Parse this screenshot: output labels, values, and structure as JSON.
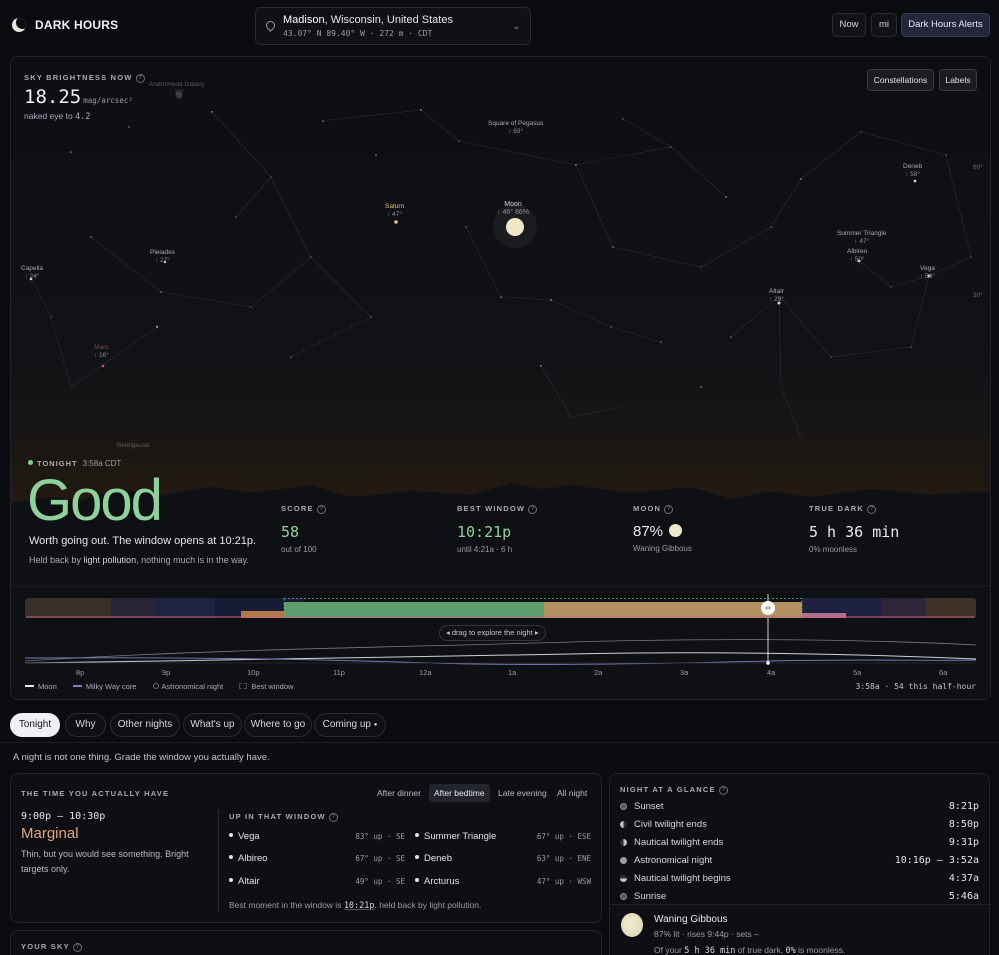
{
  "app": {
    "title": "DARK HOURS"
  },
  "location": {
    "city": "Madison",
    "region": ", Wisconsin, United States",
    "coords": "43.07° N 89.40° W · 272 m · CDT"
  },
  "header_buttons": {
    "now": "Now",
    "units": "mi",
    "alerts": "Dark Hours Alerts"
  },
  "sky": {
    "brightness_label": "SKY BRIGHTNESS NOW",
    "brightness_value": "18.25",
    "brightness_unit": "mag/arcsec²",
    "naked_eye_prefix": "naked eye to",
    "naked_eye_value": "4.2",
    "toggle_constellations": "Constellations",
    "toggle_labels": "Labels",
    "altitude_ticks": [
      "60°",
      "30°"
    ],
    "objects": [
      {
        "name": "Andromeda Galaxy",
        "alt": "↑ 19°"
      },
      {
        "name": "Square of Pegasus",
        "alt": "↑ 69°"
      },
      {
        "name": "Moon",
        "alt": "↑ 46° 86%"
      },
      {
        "name": "Saturn",
        "alt": "↑ 47°"
      },
      {
        "name": "Deneb",
        "alt": "↑ 58°"
      },
      {
        "name": "Summer Triangle",
        "alt": "↑ 47°"
      },
      {
        "name": "Albireo",
        "alt": "↑ 50°"
      },
      {
        "name": "Vega",
        "alt": "↑ 54°"
      },
      {
        "name": "Pleiades",
        "alt": "↑ 27°"
      },
      {
        "name": "Capella",
        "alt": "↑ 24°"
      },
      {
        "name": "Altair",
        "alt": "↑ 29°"
      },
      {
        "name": "Mars",
        "alt": "↑ 16°"
      },
      {
        "name": "Betelgeuse",
        "alt": ""
      }
    ]
  },
  "tonight": {
    "label": "TONIGHT",
    "time": "3:58a CDT",
    "verdict": "Good",
    "summary": "Worth going out. The window opens at 10:21p.",
    "note_prefix": "Held back by ",
    "note_bold": "light pollution",
    "note_suffix": ", nothing much is in the way."
  },
  "stats": {
    "score": {
      "label": "SCORE",
      "value": "58",
      "sub": "out of 100"
    },
    "best_window": {
      "label": "BEST WINDOW",
      "value": "10:21p",
      "sub": "until 4:21a · 6 h"
    },
    "moon": {
      "label": "MOON",
      "value": "87%",
      "sub": "Waning Gibbous"
    },
    "true_dark": {
      "label": "TRUE DARK",
      "value": "5 h 36 min",
      "sub": "0% moonless"
    }
  },
  "timeline": {
    "hint": "◂ drag to explore the night ▸",
    "hours": [
      "8p",
      "9p",
      "10p",
      "11p",
      "12a",
      "1a",
      "2a",
      "3a",
      "4a",
      "5a",
      "6a"
    ],
    "legend": {
      "moon": "Moon",
      "milky_way": "Milky Way core",
      "astro": "Astronomical night",
      "best": "Best window"
    },
    "readout": "3:58a · 54 this half-hour"
  },
  "tabs": [
    "Tonight",
    "Why",
    "Other nights",
    "What's up",
    "Where to go",
    "Coming up"
  ],
  "intro": "A night is not one thing. Grade the window you actually have.",
  "time_card": {
    "title": "THE TIME YOU ACTUALLY HAVE",
    "modes": [
      "After dinner",
      "After bedtime",
      "Late evening",
      "All night"
    ],
    "range": "9:00p – 10:30p",
    "verdict": "Marginal",
    "desc": "Thin, but you would see something. Bright targets only.",
    "up_title": "UP IN THAT WINDOW",
    "up_items": [
      {
        "name": "Vega",
        "meta": "83° up · SE"
      },
      {
        "name": "Summer Triangle",
        "meta": "67° up · ESE"
      },
      {
        "name": "Albireo",
        "meta": "67° up · SE"
      },
      {
        "name": "Deneb",
        "meta": "63° up · ENE"
      },
      {
        "name": "Altair",
        "meta": "49° up · SE"
      },
      {
        "name": "Arcturus",
        "meta": "47° up · WSW"
      }
    ],
    "best_prefix": "Best moment in the window is ",
    "best_time": "10:21p",
    "best_suffix": ", held back by light pollution."
  },
  "glance": {
    "title": "NIGHT AT A GLANCE",
    "events": [
      {
        "name": "Sunset",
        "time": "8:21p"
      },
      {
        "name": "Civil twilight ends",
        "time": "8:50p"
      },
      {
        "name": "Nautical twilight ends",
        "time": "9:31p"
      },
      {
        "name": "Astronomical night",
        "time": "10:16p – 3:52a"
      },
      {
        "name": "Nautical twilight begins",
        "time": "4:37a"
      },
      {
        "name": "Sunrise",
        "time": "5:46a"
      }
    ],
    "moon_name": "Waning Gibbous",
    "moon_meta": "87% lit · rises 9:44p · sets –",
    "moon_note_prefix": "Of your ",
    "moon_note_dark": "5 h 36 min",
    "moon_note_mid": " of true dark, ",
    "moon_note_pct": "0%",
    "moon_note_suffix": " is moonless."
  },
  "your_sky": {
    "title": "YOUR SKY"
  }
}
